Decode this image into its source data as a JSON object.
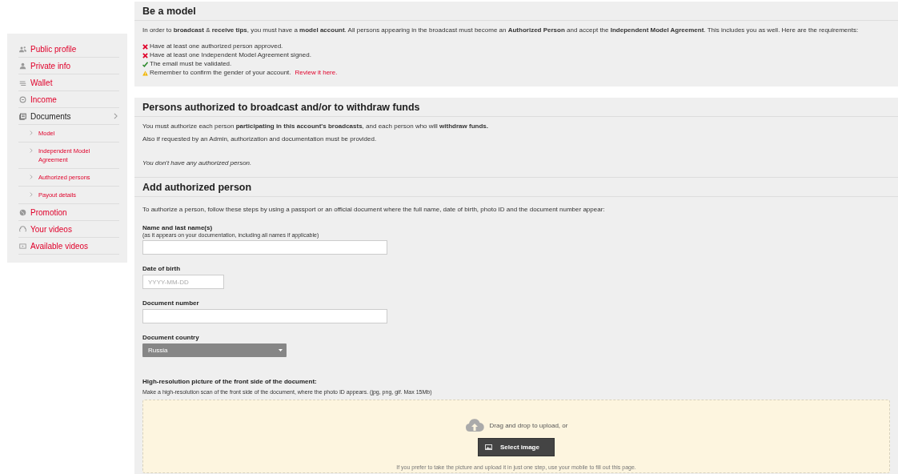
{
  "sidebar": {
    "items": [
      {
        "label": "Public profile",
        "selected": false
      },
      {
        "label": "Private info",
        "selected": false
      },
      {
        "label": "Wallet",
        "selected": false
      },
      {
        "label": "Income",
        "selected": false
      },
      {
        "label": "Documents",
        "selected": true,
        "expanded": true,
        "children": [
          {
            "label": "Model",
            "selected": false
          },
          {
            "label": "Independent Model Agreement",
            "selected": false
          },
          {
            "label": "Authorized persons",
            "selected": false
          },
          {
            "label": "Payout details",
            "selected": false
          }
        ]
      },
      {
        "label": "Promotion",
        "selected": false
      },
      {
        "label": "Your videos",
        "selected": false
      },
      {
        "label": "Available videos",
        "selected": false
      }
    ]
  },
  "be_model": {
    "title": "Be a model",
    "intro": "In order to **broadcast** & **receive tips**, you must have a **model account**. All persons appearing in the broadcast must become an **Authorized Person** and accept the **Independent Model Agreement**. This includes you as well. Here are the requirements:",
    "requirements": [
      {
        "kind": "fail",
        "text": "Have at least one authorized person approved."
      },
      {
        "kind": "fail",
        "text": "Have at least one Independent Model Agreement signed."
      },
      {
        "kind": "ok",
        "text": "The email must be validated."
      },
      {
        "kind": "warn",
        "text": "Remember to confirm the gender of your account.",
        "link": "Review it here."
      }
    ]
  },
  "persons": {
    "title": "Persons authorized to broadcast and/or to withdraw funds",
    "paragraphs": [
      "You must authorize each person **participating in this account's broadcasts**, and each person who will **withdraw funds.**",
      "Also if requested by an Admin, authorization and documentation must be provided."
    ],
    "empty_note": "You don't have any authorized person."
  },
  "add_person": {
    "title": "Add authorized person",
    "instructions": "To authorize a person, follow these steps by using a passport or an official document where the full name, date of birth, photo ID and the document number appear:",
    "fields": [
      {
        "kind": "text",
        "label": "Name and last name(s)",
        "hint": "(as it appears on your documentation, including all names if applicable)"
      },
      {
        "kind": "text",
        "label": "Date of birth",
        "placeholder": "YYYY-MM-DD"
      },
      {
        "kind": "text",
        "label": "Document number"
      },
      {
        "kind": "select",
        "label": "Document country",
        "value": "Russia"
      }
    ],
    "upload": {
      "label": "High-resolution picture of the front side of the document:",
      "hint": "Make a high-resolution scan of the front side of the document, where the photo ID appears. (jpg, png, gif. Max 15Mb)",
      "drop_text": "Drag and drop to upload, or",
      "button": "Select image",
      "footnote": "If you prefer to take the picture and upload it in just one step, use your mobile to fill out this page."
    }
  }
}
